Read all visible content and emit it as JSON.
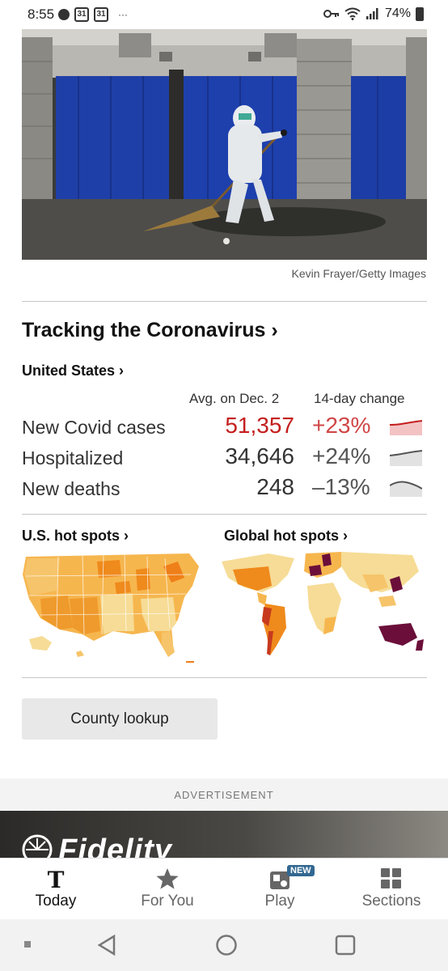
{
  "status_bar": {
    "time": "8:55",
    "calendar_day_1": "31",
    "calendar_day_2": "31",
    "overflow": "···",
    "battery": "74%"
  },
  "hero": {
    "credit": "Kevin Frayer/Getty Images"
  },
  "tracker": {
    "title": "Tracking the Coronavirus ›",
    "region_link": "United States ›",
    "col_avg": "Avg. on Dec. 2",
    "col_change": "14-day change",
    "rows": [
      {
        "label": "New Covid cases",
        "value": "51,357",
        "change": "+23%",
        "trend": "up"
      },
      {
        "label": "Hospitalized",
        "value": "34,646",
        "change": "+24%",
        "trend": "up"
      },
      {
        "label": "New deaths",
        "value": "248",
        "change": "–13%",
        "trend": "down"
      }
    ],
    "us_hot_spots": "U.S. hot spots ›",
    "global_hot_spots": "Global hot spots ›",
    "county_lookup": "County lookup"
  },
  "colors": {
    "cases_red": "#c41e1e",
    "cases_fill": "#f3c3c4",
    "map_light": "#f6dc96",
    "map_mid": "#f6b64e",
    "map_dark": "#ef8a1c",
    "map_red": "#c73a1e",
    "map_maroon": "#6b0f3a"
  },
  "advertisement": {
    "label": "ADVERTISEMENT",
    "brand": "Fidelity"
  },
  "bottom_nav": {
    "items": [
      {
        "label": "Today",
        "icon": "nyt-logo-icon",
        "active": true
      },
      {
        "label": "For You",
        "icon": "star-icon",
        "active": false
      },
      {
        "label": "Play",
        "icon": "play-games-icon",
        "active": false,
        "badge": "NEW"
      },
      {
        "label": "Sections",
        "icon": "grid-icon",
        "active": false
      }
    ]
  }
}
